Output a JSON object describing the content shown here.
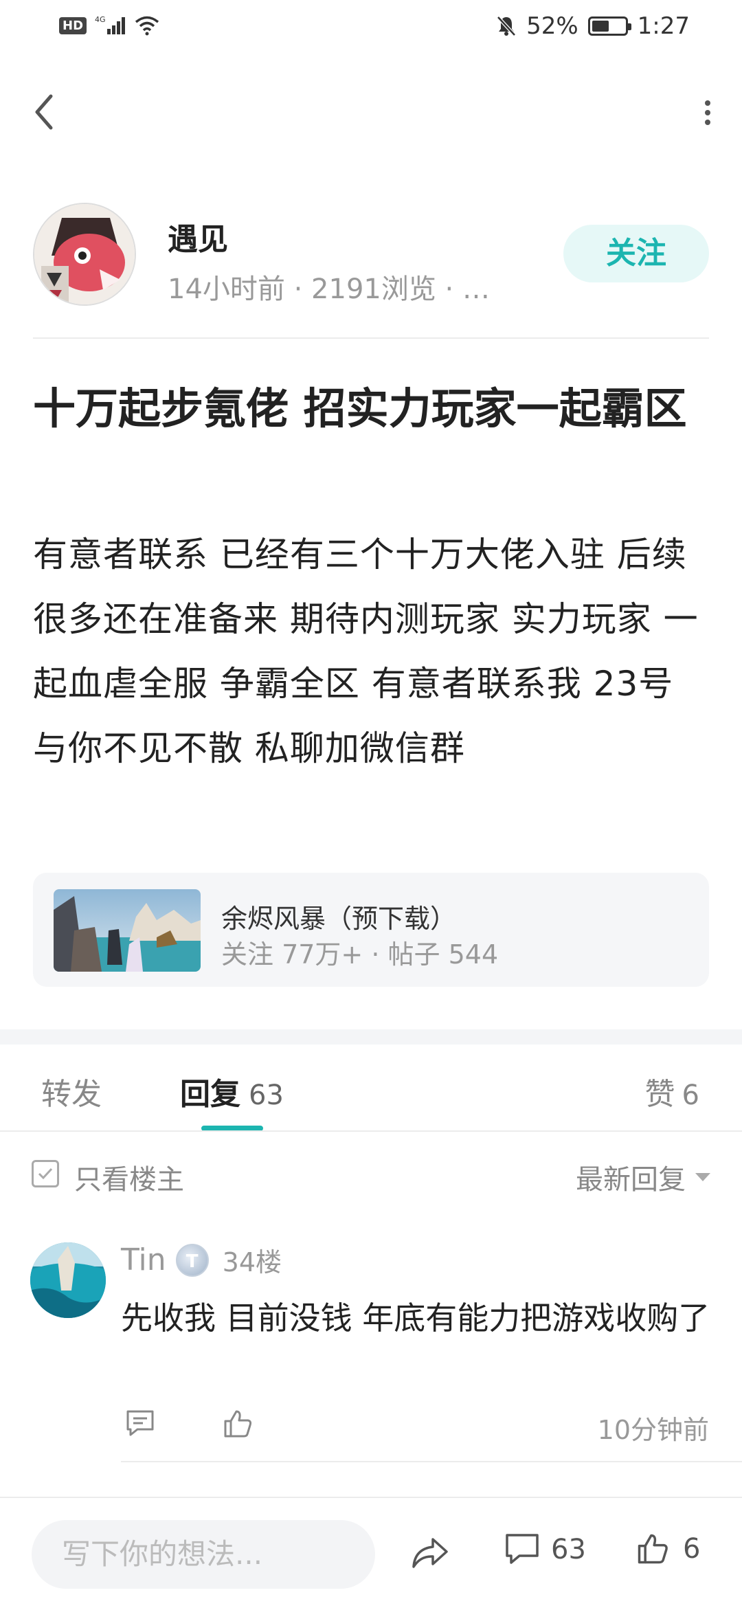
{
  "status_bar": {
    "hd": "HD",
    "network": "4G",
    "battery_percent": "52%",
    "battery_level": 0.52,
    "time": "1:27"
  },
  "nav": {
    "back_icon": "chevron-left-icon",
    "more_icon": "more-vertical-icon"
  },
  "author": {
    "name": "遇见",
    "meta": "14小时前 · 2191浏览 · …",
    "follow_label": "关注"
  },
  "post": {
    "title": "十万起步氪佬  招实力玩家一起霸区",
    "body": "有意者联系  已经有三个十万大佬入驻  后续很多还在准备来  期待内测玩家 实力玩家 一起血虐全服  争霸全区  有意者联系我   23号  与你不见不散   私聊加微信群"
  },
  "game_card": {
    "name": "余烬风暴（预下载）",
    "stats": "关注 77万+ · 帖子 544"
  },
  "tabs": {
    "repost": "转发",
    "reply": "回复",
    "reply_count": "63",
    "like": "赞",
    "like_count": "6"
  },
  "filter": {
    "only_op": "只看楼主",
    "sort": "最新回复"
  },
  "comments": [
    {
      "user": "Tin",
      "badge": "T",
      "floor": "34楼",
      "text": "先收我 目前没钱 年底有能力把游戏收购了",
      "time": "10分钟前"
    }
  ],
  "bottom_bar": {
    "placeholder": "写下你的想法...",
    "comment_count": "63",
    "like_count": "6"
  },
  "colors": {
    "accent": "#1cb5b0",
    "follow_bg": "#e6f8f7"
  }
}
